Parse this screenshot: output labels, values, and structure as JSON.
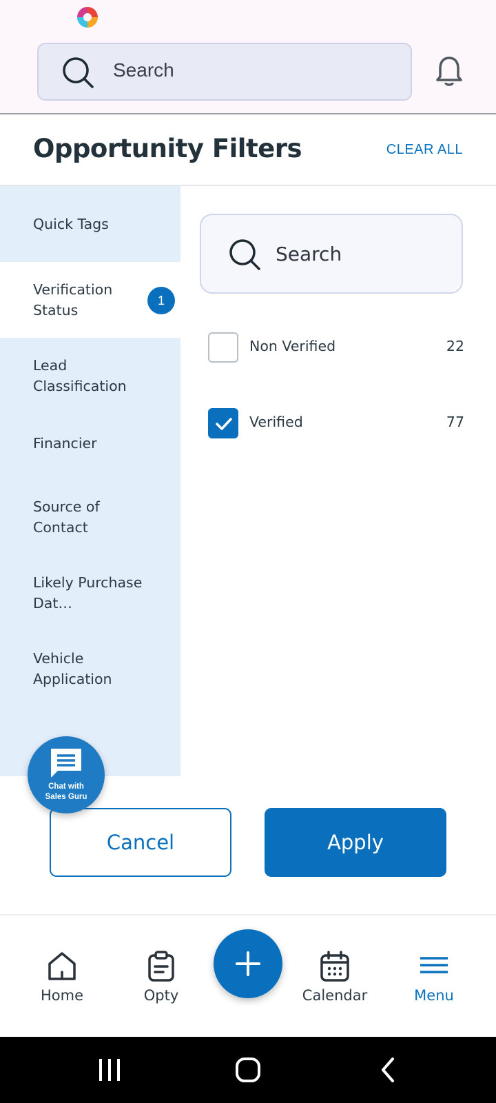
{
  "top_bar": {
    "search_label": "Search",
    "icons": [
      "app-logo-icon",
      "search-icon",
      "bell-icon"
    ]
  },
  "filters": {
    "title": "Opportunity Filters",
    "clear_all": "CLEAR ALL"
  },
  "sidebar": {
    "items": [
      {
        "label": "Quick Tags",
        "active": false
      },
      {
        "label": "Verification Status",
        "active": true,
        "badge": "1"
      },
      {
        "label": "Lead Classification",
        "active": false
      },
      {
        "label": "Financier",
        "active": false
      },
      {
        "label": "Source of Contact",
        "active": false
      },
      {
        "label": "Likely Purchase Dat…",
        "active": false
      },
      {
        "label": "Vehicle Application",
        "active": false
      }
    ]
  },
  "content": {
    "search_label": "Search",
    "options": [
      {
        "label": "Non Verified",
        "count": "22",
        "checked": false
      },
      {
        "label": "Verified",
        "count": "77",
        "checked": true
      }
    ]
  },
  "chat": {
    "line1": "Chat with",
    "line2": "Sales Guru"
  },
  "actions": {
    "cancel": "Cancel",
    "apply": "Apply"
  },
  "bottom_nav": {
    "items": [
      {
        "label": "Home",
        "icon": "home-icon",
        "active": false
      },
      {
        "label": "Opty",
        "icon": "clipboard-icon",
        "active": false
      },
      {
        "label": "Calendar",
        "icon": "calendar-icon",
        "active": false
      },
      {
        "label": "Menu",
        "icon": "menu-icon",
        "active": true
      }
    ],
    "fab_icon": "plus-icon"
  },
  "colors": {
    "accent": "#0a70bd",
    "sidebar_bg": "#e3eefb",
    "header_bg": "#fdf7fb"
  }
}
